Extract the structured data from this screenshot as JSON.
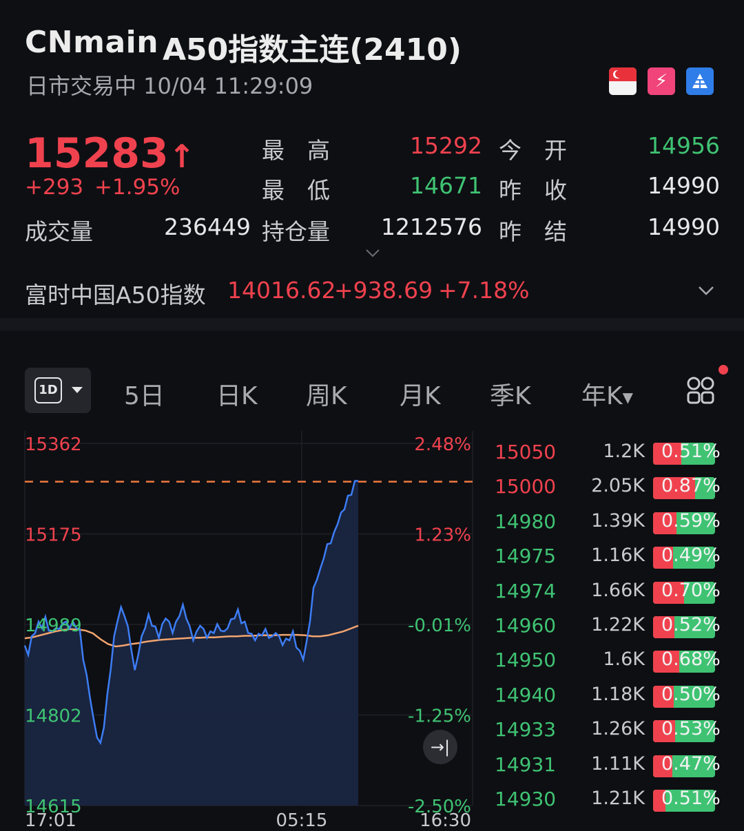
{
  "header": {
    "code": "CNmain",
    "name": "A50指数主连(2410)",
    "status": "日市交易中 10/04 11:29:09",
    "icons": [
      "singapore-flag-icon",
      "f2-icon",
      "pyramid-icon"
    ]
  },
  "quote": {
    "price": "15283",
    "arrow": "↑",
    "change": "+293",
    "change_pct": "+1.95%",
    "high_label": "最　高",
    "high": "15292",
    "low_label": "最　低",
    "low": "14671",
    "volume_label": "成交量",
    "volume": "236449",
    "oi_label": "持仓量",
    "oi": "1212576",
    "open_label": "今　开",
    "open": "14956",
    "prev_close_label": "昨　收",
    "prev_close": "14990",
    "prev_settle_label": "昨　结",
    "prev_settle": "14990"
  },
  "index": {
    "name": "富时中国A50指数",
    "value": "14016.62",
    "change": "+938.69",
    "change_pct": "+7.18%"
  },
  "tabs": {
    "period": "1D",
    "items": [
      "5日",
      "日K",
      "周K",
      "月K",
      "季K",
      "年K"
    ]
  },
  "colors": {
    "up": "#f0424e",
    "down": "#3fc373",
    "line": "#3d7df5",
    "avg": "#f3a56f"
  },
  "chart_data": {
    "type": "line",
    "title": "",
    "y_left_ticks": [
      "15362",
      "15175",
      "14989",
      "14802",
      "14615"
    ],
    "y_right_ticks": [
      "2.48%",
      "1.23%",
      "-0.01%",
      "-1.25%",
      "-2.50%"
    ],
    "x_ticks": [
      "17:01",
      "05:15",
      "16:30"
    ],
    "ylim": [
      14615,
      15362
    ],
    "reference_price": 15283,
    "series": [
      {
        "values": [
          14945,
          14930,
          14960,
          14975,
          14990,
          14985,
          15000,
          14980,
          14970,
          14985,
          14975,
          14995,
          14990,
          14985,
          14990,
          14985,
          14975,
          14920,
          14880,
          14840,
          14790,
          14760,
          14740,
          14780,
          14840,
          14900,
          14960,
          15000,
          15020,
          15010,
          14980,
          14940,
          14890,
          14930,
          14960,
          14985,
          15005,
          14990,
          14980,
          14965,
          14985,
          15005,
          14990,
          14975,
          14990,
          15010,
          15025,
          15005,
          14980,
          14960,
          14970,
          14990,
          14975,
          14965,
          14970,
          14975,
          14985,
          14980,
          14970,
          14985,
          14995,
          15005,
          15015,
          14995,
          14990,
          14975,
          14965,
          14960,
          14965,
          14970,
          14975,
          14965,
          14960,
          14975,
          14960,
          14950,
          14955,
          14960,
          14970,
          14945,
          14930,
          14920,
          14950,
          15000,
          15060,
          15085,
          15100,
          15130,
          15150,
          15160,
          15175,
          15200,
          15215,
          15230,
          15250,
          15260,
          15280,
          15285
        ],
        "avg": [
          14960,
          14962,
          14966,
          14970,
          14974,
          14977,
          14979,
          14978,
          14976,
          14970,
          14958,
          14948,
          14943,
          14945,
          14948,
          14950,
          14953,
          14955,
          14957,
          14958,
          14959,
          14960,
          14961,
          14961,
          14962,
          14962,
          14963,
          14964,
          14964,
          14965,
          14965,
          14966,
          14966,
          14966,
          14967,
          14967,
          14967,
          14966,
          14964,
          14964,
          14966,
          14970,
          14974,
          14980,
          14986
        ]
      }
    ]
  },
  "orderbook": [
    {
      "price": "15050",
      "vol": "1.2K",
      "pct": "0.51%",
      "up": true,
      "ratio": 0.45
    },
    {
      "price": "15000",
      "vol": "2.05K",
      "pct": "0.87%",
      "up": true,
      "ratio": 0.68
    },
    {
      "price": "14980",
      "vol": "1.39K",
      "pct": "0.59%",
      "up": false,
      "ratio": 0.38
    },
    {
      "price": "14975",
      "vol": "1.16K",
      "pct": "0.49%",
      "up": false,
      "ratio": 0.32
    },
    {
      "price": "14974",
      "vol": "1.66K",
      "pct": "0.70%",
      "up": false,
      "ratio": 0.5
    },
    {
      "price": "14960",
      "vol": "1.22K",
      "pct": "0.52%",
      "up": false,
      "ratio": 0.34
    },
    {
      "price": "14950",
      "vol": "1.6K",
      "pct": "0.68%",
      "up": false,
      "ratio": 0.42
    },
    {
      "price": "14940",
      "vol": "1.18K",
      "pct": "0.50%",
      "up": false,
      "ratio": 0.33
    },
    {
      "price": "14933",
      "vol": "1.26K",
      "pct": "0.53%",
      "up": false,
      "ratio": 0.35
    },
    {
      "price": "14931",
      "vol": "1.11K",
      "pct": "0.47%",
      "up": false,
      "ratio": 0.31
    },
    {
      "price": "14930",
      "vol": "1.21K",
      "pct": "0.51%",
      "up": false,
      "ratio": 0.2
    }
  ]
}
